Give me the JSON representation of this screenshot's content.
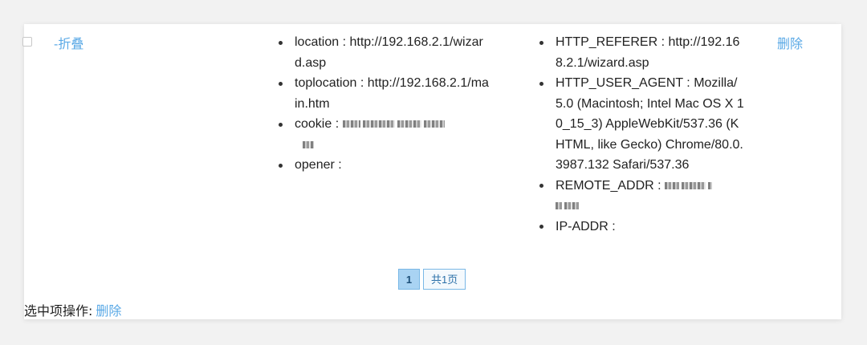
{
  "row": {
    "collapse_label": "-折叠",
    "delete_label": "删除",
    "col1_items": [
      {
        "text": "location : http://192.168.2.1/wizard.asp"
      },
      {
        "text": "toplocation : http://192.168.2.1/main.htm"
      },
      {
        "text": "cookie :"
      },
      {
        "text": "opener :"
      }
    ],
    "col2_items": [
      {
        "text": "HTTP_REFERER : http://192.168.2.1/wizard.asp"
      },
      {
        "text": "HTTP_USER_AGENT : Mozilla/5.0 (Macintosh; Intel Mac OS X 10_15_3) AppleWebKit/537.36 (KHTML, like Gecko) Chrome/80.0.3987.132 Safari/537.36"
      },
      {
        "text": "REMOTE_ADDR :"
      },
      {
        "text": "IP-ADDR :"
      }
    ]
  },
  "pagination": {
    "current_page": "1",
    "total_label": "共1页"
  },
  "bulk_actions": {
    "label": "选中项操作:",
    "delete_label": "删除"
  },
  "colors": {
    "link": "#5aa9e6",
    "page_active_bg": "#a9d3f3",
    "page_border": "#7ab8e6"
  }
}
